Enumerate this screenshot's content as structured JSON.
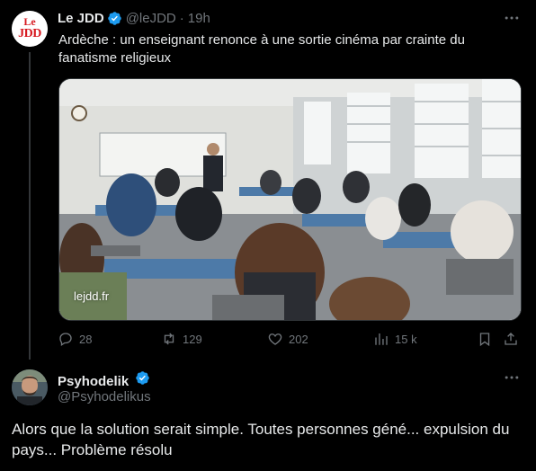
{
  "tweet": {
    "author_name": "Le JDD",
    "author_handle": "@leJDD",
    "separator": "·",
    "time": "19h",
    "avatar_logo_top": "Le",
    "avatar_logo_bottom": "JDD",
    "text": "Ardèche : un enseignant renonce à une sortie cinéma par crainte du fanatisme religieux",
    "link_card_domain": "lejdd.fr",
    "stats": {
      "replies": "28",
      "reposts": "129",
      "likes": "202",
      "views": "15 k"
    },
    "icons": [
      "verified-badge-icon",
      "more-icon",
      "reply-icon",
      "repost-icon",
      "like-icon",
      "views-icon",
      "bookmark-icon",
      "share-icon"
    ]
  },
  "reply": {
    "author_name": "Psyhodelik",
    "author_handle": "@Psyhodelikus",
    "text": "Alors que la solution serait simple. Toutes personnes géné... expulsion du pays... Problème résolu"
  },
  "colors": {
    "background": "#000000",
    "text": "#e7e9ea",
    "muted": "#71767b",
    "verified": "#1d9bf0",
    "brand_red": "#d71920"
  }
}
